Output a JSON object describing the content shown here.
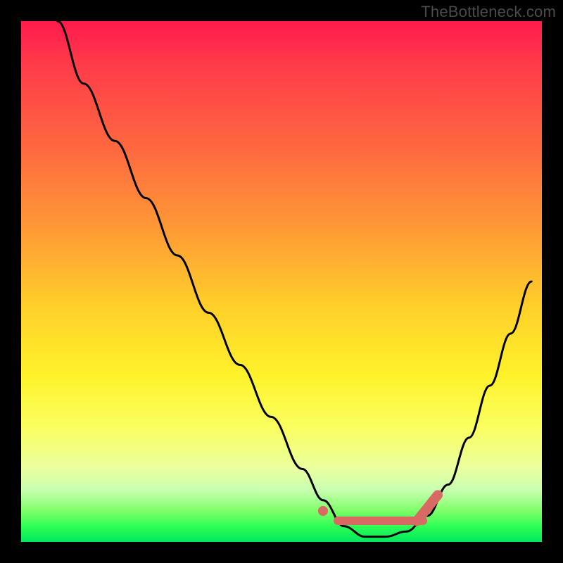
{
  "attribution": "TheBottleneck.com",
  "colors": {
    "frame": "#000000",
    "curve": "#000000",
    "marker": "#d86a63"
  },
  "chart_data": {
    "type": "line",
    "title": "",
    "xlabel": "",
    "ylabel": "",
    "xlim": [
      0,
      100
    ],
    "ylim": [
      0,
      100
    ],
    "series": [
      {
        "name": "bottleneck-curve",
        "x": [
          7,
          12,
          18,
          24,
          30,
          36,
          42,
          48,
          54,
          58,
          62,
          66,
          70,
          74,
          78,
          82,
          86,
          90,
          94,
          98
        ],
        "y": [
          100,
          88,
          77,
          66,
          55,
          44,
          34,
          24,
          14,
          8,
          3,
          1,
          1,
          2,
          5,
          11,
          20,
          30,
          40,
          50
        ]
      }
    ],
    "markers": {
      "dot": {
        "x": 58,
        "y": 6
      },
      "bar": {
        "x_start": 60,
        "x_end": 78,
        "y": 4
      },
      "tail": {
        "x_start": 76,
        "x_end": 80,
        "y_start": 4,
        "y_end": 9
      }
    },
    "gradient_stops": [
      {
        "pos": 0,
        "color": "#ff1a4d"
      },
      {
        "pos": 25,
        "color": "#ff6a3f"
      },
      {
        "pos": 55,
        "color": "#ffd02a"
      },
      {
        "pos": 78,
        "color": "#faff60"
      },
      {
        "pos": 94,
        "color": "#7fff6a"
      },
      {
        "pos": 100,
        "color": "#00e85d"
      }
    ]
  }
}
